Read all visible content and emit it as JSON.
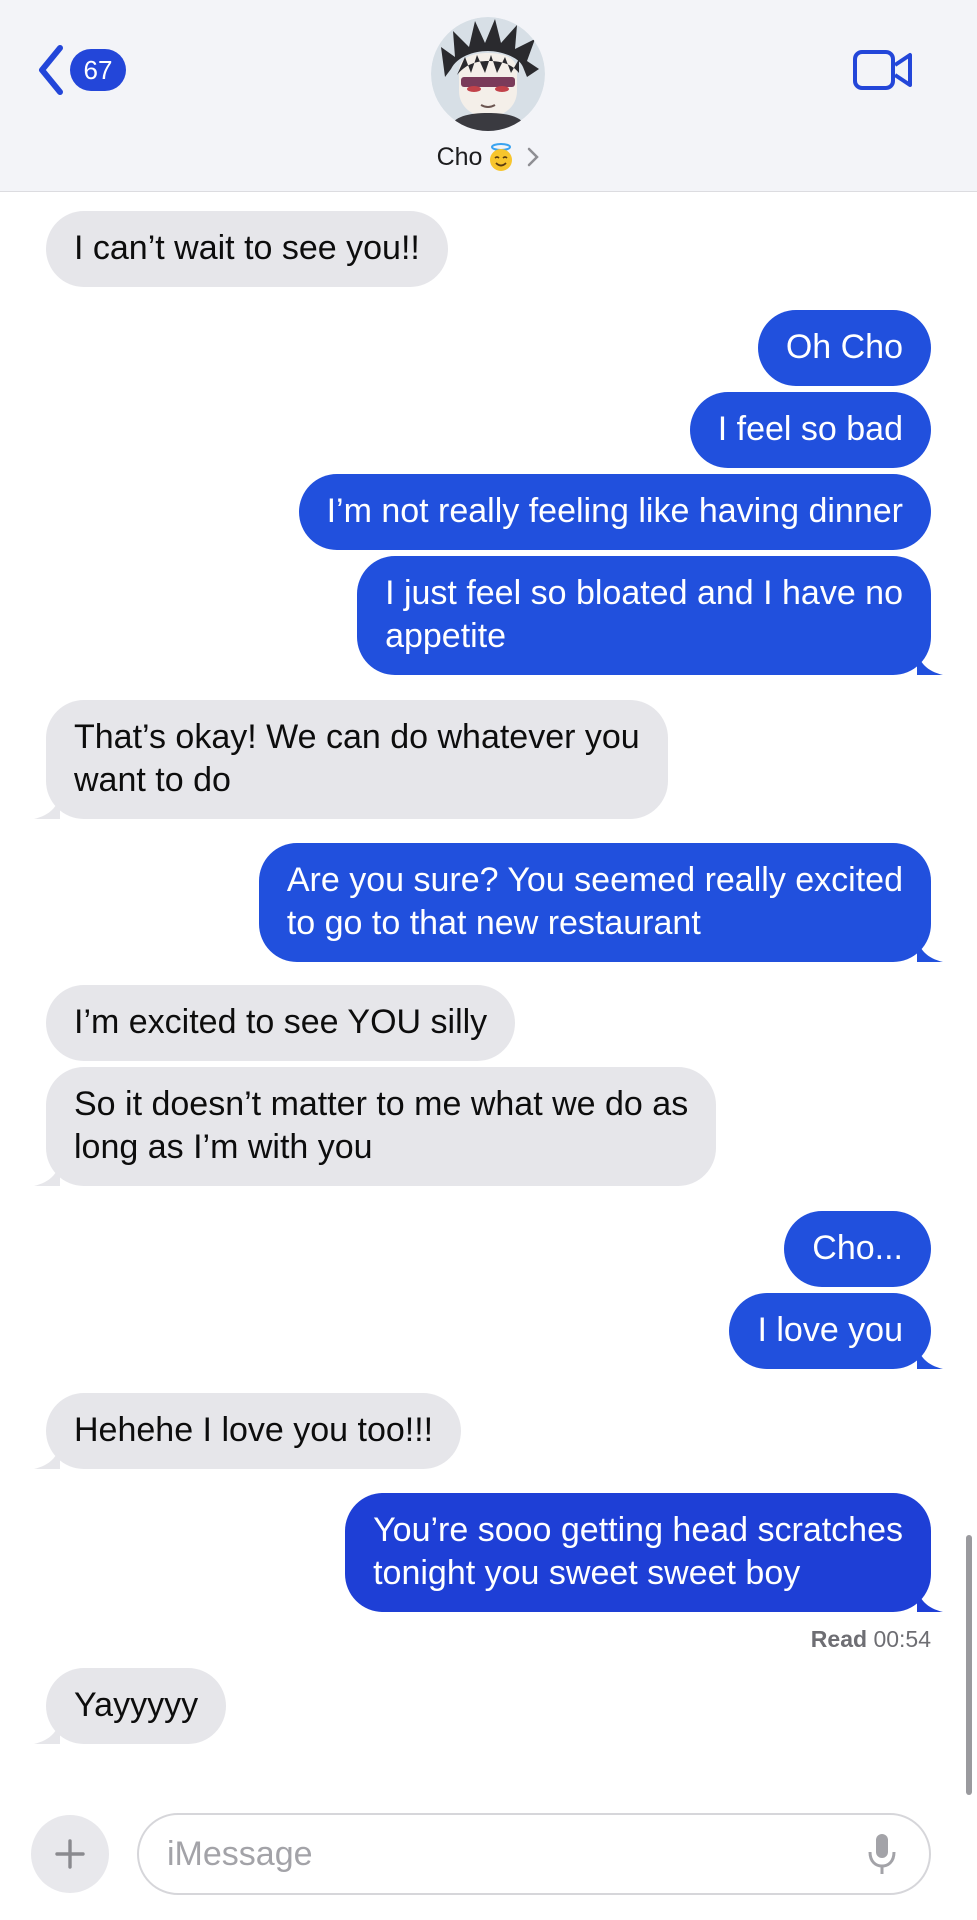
{
  "header": {
    "back_badge": "67",
    "contact_name": "Cho"
  },
  "messages": [
    {
      "from": "contact",
      "text": "I can’t wait to see you!!"
    },
    {
      "from": "me",
      "text": "Oh Cho"
    },
    {
      "from": "me",
      "text": "I feel so bad"
    },
    {
      "from": "me",
      "text": "I’m not really feeling like having dinner"
    },
    {
      "from": "me",
      "lines": [
        "I just feel so bloated and I have no",
        "appetite"
      ]
    },
    {
      "from": "contact",
      "lines": [
        "That’s okay! We can do whatever you",
        "want to do"
      ]
    },
    {
      "from": "me",
      "lines": [
        "Are you sure? You seemed really excited",
        "to go to that new restaurant"
      ]
    },
    {
      "from": "contact",
      "text": "I’m excited to see YOU silly"
    },
    {
      "from": "contact",
      "lines": [
        "So it doesn’t matter to me what we do as",
        "long as I’m with you"
      ]
    },
    {
      "from": "me",
      "text": "Cho..."
    },
    {
      "from": "me",
      "text": "I love you"
    },
    {
      "from": "contact",
      "text": "Hehehe I love you too!!!"
    },
    {
      "from": "me",
      "lines": [
        "You’re sooo getting head scratches",
        "tonight you sweet sweet boy"
      ]
    },
    {
      "from": "contact",
      "text": "Yayyyyy"
    }
  ],
  "read_receipt": {
    "label": "Read",
    "time": "00:54"
  },
  "composer": {
    "placeholder": "iMessage"
  },
  "colors": {
    "sent_bubble": "#2150dd",
    "received_bubble": "#e6e6ea",
    "accent": "#2346d9"
  },
  "icons": [
    "back-chevron-icon",
    "video-camera-icon",
    "halo-smile-emoji-icon",
    "chevron-right-icon",
    "plus-icon",
    "microphone-icon"
  ]
}
